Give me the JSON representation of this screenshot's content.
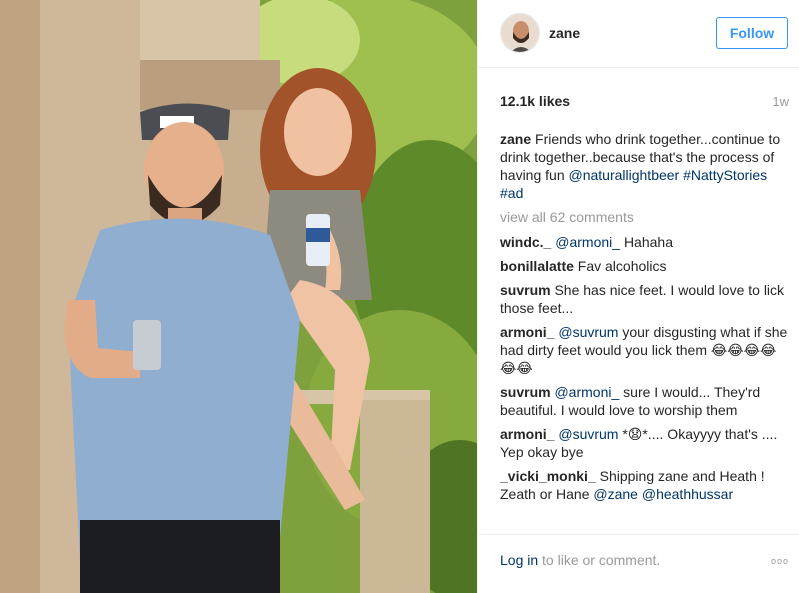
{
  "header": {
    "username": "zane",
    "follow_label": "Follow"
  },
  "stats": {
    "likes": "12.1k likes",
    "time_ago": "1w"
  },
  "caption": {
    "author": "zane",
    "text": "Friends who drink together...continue to drink together..because that's the process of having fun",
    "mention": "@naturallightbeer",
    "hashtag1": "#NattyStories",
    "hashtag2": "#ad"
  },
  "view_all": "view all 62 comments",
  "comments": [
    {
      "author": "windc._",
      "mention": "@armoni_",
      "text": "Hahaha"
    },
    {
      "author": "bonillalatte",
      "text": "Fav alcoholics"
    },
    {
      "author": "suvrum",
      "text": "She has nice feet. I would love to lick those feet..."
    },
    {
      "author": "armoni_",
      "mention": "@suvrum",
      "text": "your disgusting what if she had dirty feet would you lick them",
      "emoji": "😂😂😂😂😂😂"
    },
    {
      "author": "suvrum",
      "mention": "@armoni_",
      "text": "sure I would... They'rd beautiful. I would love to worship them"
    },
    {
      "author": "armoni_",
      "mention": "@suvrum",
      "text": "*😧*.... Okayyyy that's .... Yep okay bye"
    },
    {
      "author": "_vicki_monki_",
      "text": "Shipping zane and Heath ! Zeath or Hane",
      "mention": "@zane",
      "mention2": "@heathhussar"
    }
  ],
  "footer": {
    "login_link": "Log in",
    "login_text": "to like or comment.",
    "more": "ooo"
  }
}
